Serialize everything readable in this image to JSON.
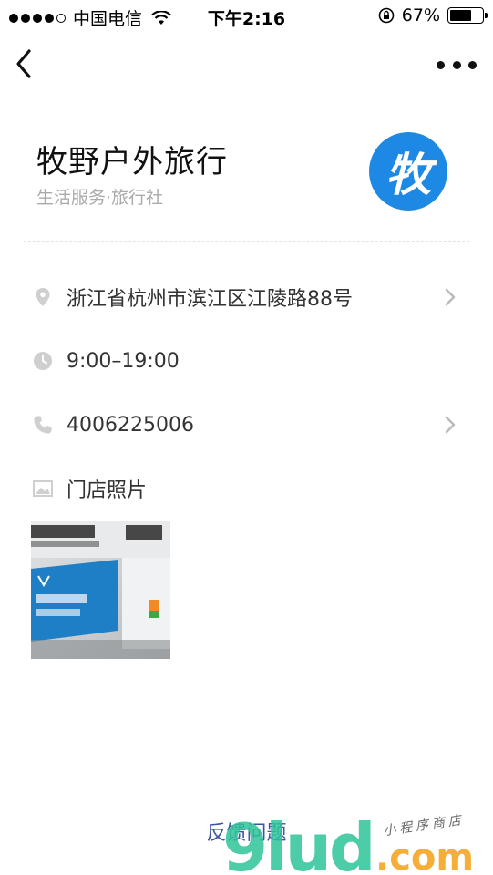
{
  "status_bar": {
    "carrier": "中国电信",
    "time": "下午2:16",
    "battery": "67%",
    "battery_level": 0.67
  },
  "nav": {
    "back_icon": "chevron-left-icon",
    "more_icon": "more-dots-icon"
  },
  "shop": {
    "name": "牧野户外旅行",
    "category": "生活服务·旅行社",
    "logo_char": "牧",
    "logo_color": "#1e88e5"
  },
  "info": {
    "address": "浙江省杭州市滨江区江陵路88号",
    "hours": "9:00–19:00",
    "phone": "4006225006",
    "photos_label": "门店照片"
  },
  "footer": {
    "feedback": "反馈问题"
  },
  "watermark": {
    "brand": "9lud",
    "domain": ".com",
    "tagline": "小程序商店"
  }
}
